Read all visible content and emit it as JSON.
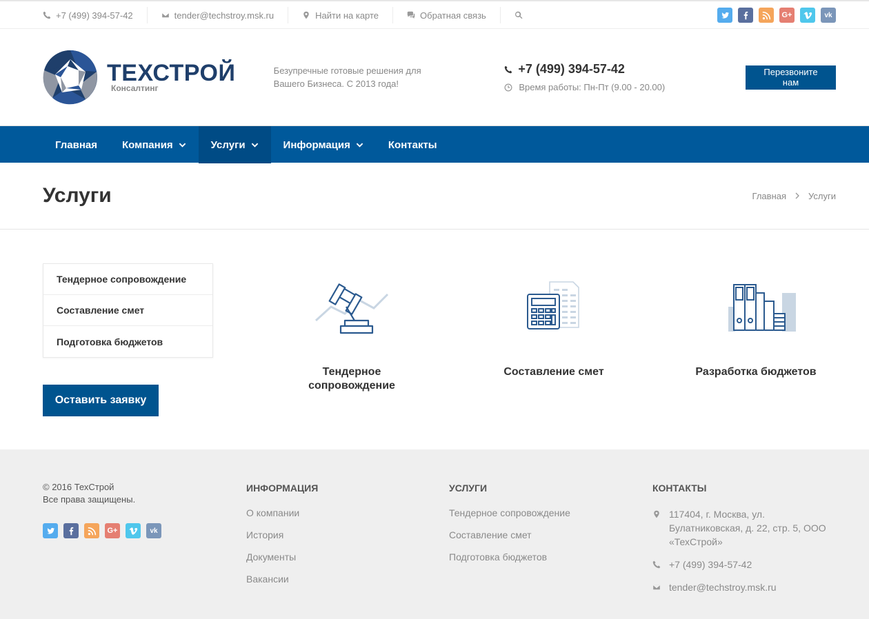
{
  "topbar": {
    "phone": "+7 (499) 394-57-42",
    "email": "tender@techstroy.msk.ru",
    "map": "Найти на карте",
    "feedback": "Обратная связь"
  },
  "social_colors": {
    "twitter": "#55acee",
    "facebook": "#3b5998",
    "rss": "#f39c12",
    "google": "#dd4b39",
    "vimeo": "#1ab7ea",
    "vk": "#4c75a3"
  },
  "header": {
    "logo_name": "ТЕХСТРОЙ",
    "logo_sub": "Консалтинг",
    "slogan_line1": "Безупречные готовые решения для",
    "slogan_line2": "Вашего Бизнеса. С 2013 года!",
    "phone": "+7 (499) 394-57-42",
    "hours": "Время работы: Пн-Пт (9.00 - 20.00)",
    "callback_button": "Перезвоните нам"
  },
  "nav": {
    "items": [
      {
        "label": "Главная"
      },
      {
        "label": "Компания"
      },
      {
        "label": "Услуги"
      },
      {
        "label": "Информация"
      },
      {
        "label": "Контакты"
      }
    ]
  },
  "page": {
    "title": "Услуги",
    "breadcrumb_home": "Главная",
    "breadcrumb_current": "Услуги"
  },
  "sidebar": {
    "items": [
      {
        "label": "Тендерное сопровождение"
      },
      {
        "label": "Составление смет"
      },
      {
        "label": "Подготовка бюджетов"
      }
    ],
    "request_button": "Оставить заявку"
  },
  "services": [
    {
      "line1": "Тендерное",
      "line2": "сопровождение"
    },
    {
      "line1": "Составление смет"
    },
    {
      "line1": "Разработка бюджетов"
    }
  ],
  "footer": {
    "copyright": "© 2016 ТехСтрой",
    "rights": "Все права защищены.",
    "info_heading": "ИНФОРМАЦИЯ",
    "info_links": [
      "О компании",
      "История",
      "Документы",
      "Вакансии"
    ],
    "services_heading": "УСЛУГИ",
    "service_links": [
      "Тендерное сопровождение",
      "Составление смет",
      "Подготовка бюджетов"
    ],
    "contacts_heading": "КОНТАКТЫ",
    "address_line1": "117404, г. Москва, ул.",
    "address_line2": "Булатниковская, д. 22, стр. 5, ООО",
    "address_line3": "«ТехСтрой»",
    "phone": "+7 (499) 394-57-42",
    "email": "tender@techstroy.msk.ru"
  }
}
